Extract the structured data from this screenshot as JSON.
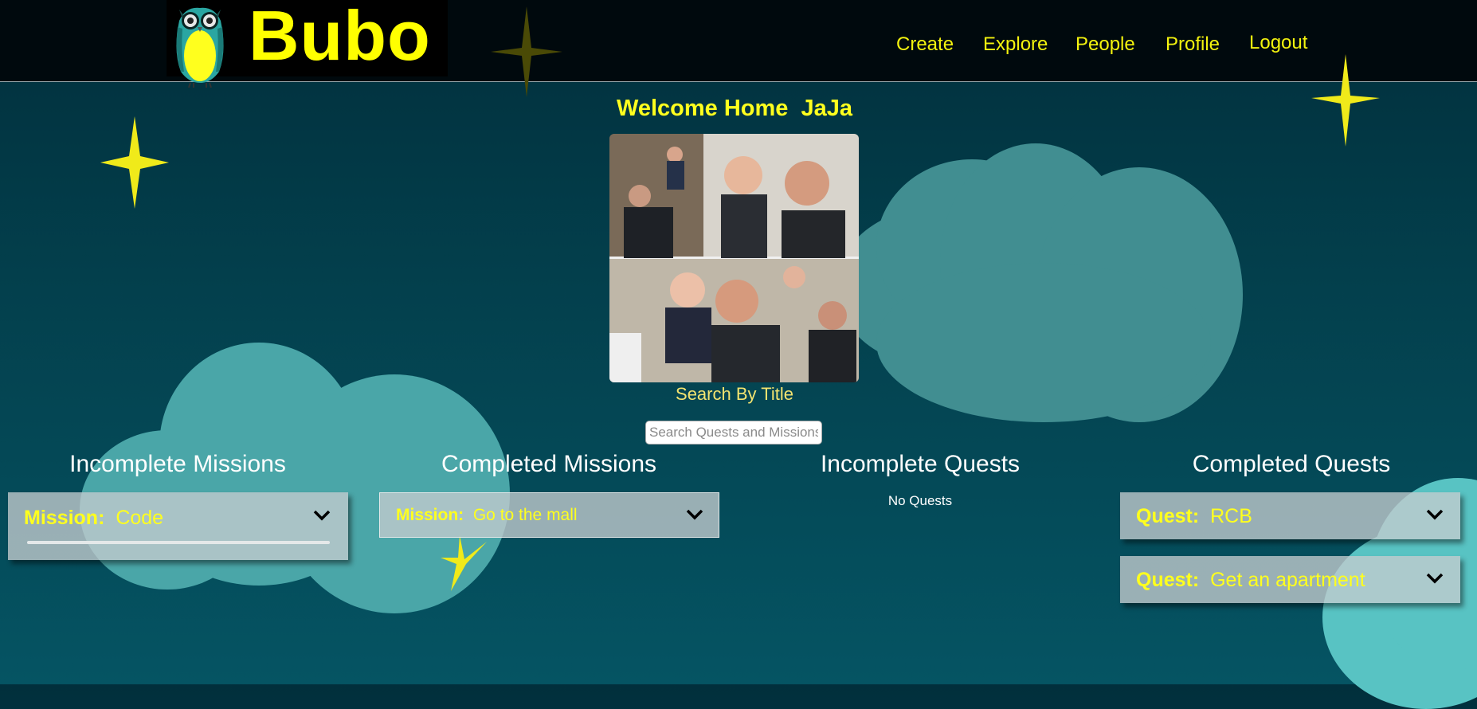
{
  "brand": {
    "name": "Bubo"
  },
  "nav": {
    "items": [
      {
        "label": "Create"
      },
      {
        "label": "Explore"
      },
      {
        "label": "People"
      },
      {
        "label": "Profile"
      },
      {
        "label": "Logout"
      }
    ]
  },
  "welcome": {
    "greeting": "Welcome Home",
    "user": "JaJa"
  },
  "search": {
    "label": "Search By Title",
    "placeholder": "Search Quests and Missions"
  },
  "columns": {
    "incomplete_missions": {
      "heading": "Incomplete Missions",
      "items": [
        {
          "kind": "Mission:",
          "title": "Code",
          "progress": 0
        }
      ]
    },
    "completed_missions": {
      "heading": "Completed Missions",
      "items": [
        {
          "kind": "Mission:",
          "title": "Go to the mall"
        }
      ]
    },
    "incomplete_quests": {
      "heading": "Incomplete Quests",
      "empty_text": "No Quests"
    },
    "completed_quests": {
      "heading": "Completed Quests",
      "items": [
        {
          "kind": "Quest:",
          "title": "RCB"
        },
        {
          "kind": "Quest:",
          "title": "Get an apartment"
        }
      ]
    }
  },
  "colors": {
    "accent_yellow": "#ffff1e",
    "nav_background": "#00090d",
    "card_background": "#c4ccce",
    "cloud": "#4aa6a8"
  },
  "icons": {
    "logo": "owl-icon",
    "decor": "star-icon",
    "card_toggle": "chevron-down-icon"
  }
}
